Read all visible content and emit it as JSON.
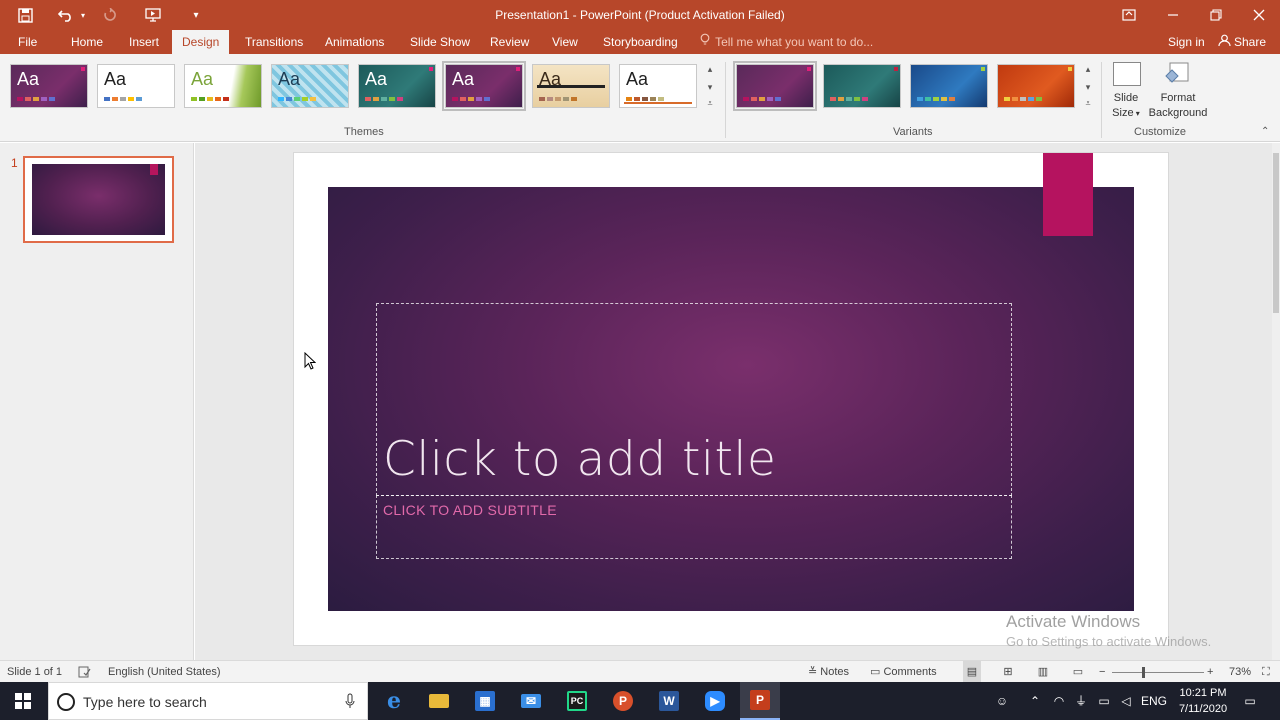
{
  "window": {
    "title": "Presentation1 - PowerPoint (Product Activation Failed)",
    "qat": {
      "save_icon": "save-icon",
      "undo_icon": "undo-icon",
      "redo_icon": "redo-icon",
      "present_icon": "present-icon",
      "customize_icon": "customize-icon"
    },
    "controls": {
      "ribbon_display": "ribbon-display-icon",
      "minimize": "minimize-icon",
      "restore": "restore-icon",
      "close": "close-icon"
    }
  },
  "ribbon_tabs": [
    {
      "label": "File"
    },
    {
      "label": "Home"
    },
    {
      "label": "Insert"
    },
    {
      "label": "Design",
      "active": true
    },
    {
      "label": "Transitions"
    },
    {
      "label": "Animations"
    },
    {
      "label": "Slide Show"
    },
    {
      "label": "Review"
    },
    {
      "label": "View"
    },
    {
      "label": "Storyboarding"
    }
  ],
  "tell_me": "Tell me what you want to do...",
  "account": {
    "sign_in": "Sign in",
    "share": "Share"
  },
  "design": {
    "themes_label": "Themes",
    "variants_label": "Variants",
    "customize_label": "Customize",
    "theme_text": "Aa",
    "slide_size": {
      "line1": "Slide",
      "line2": "Size"
    },
    "format_background": {
      "line1": "Format",
      "line2": "Background"
    },
    "accent_color": "#b5135f"
  },
  "slides_pane": {
    "number": "1"
  },
  "slide": {
    "title_placeholder": "Click to add title",
    "subtitle_placeholder": "CLICK TO ADD SUBTITLE"
  },
  "watermark": {
    "line1": "Activate Windows",
    "line2": "Go to Settings to activate Windows."
  },
  "status": {
    "slide_count": "Slide 1 of 1",
    "language": "English (United States)",
    "notes": "Notes",
    "comments": "Comments",
    "zoom": "73%"
  },
  "taskbar": {
    "search_placeholder": "Type here to search",
    "lang": "ENG",
    "time": "10:21 PM",
    "date": "7/11/2020"
  }
}
